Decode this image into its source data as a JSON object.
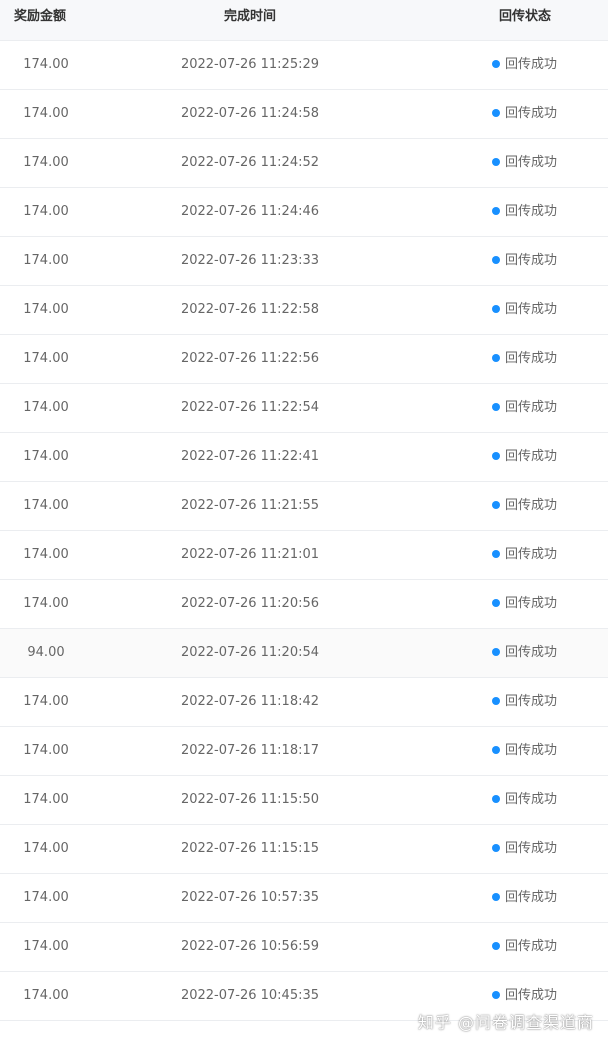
{
  "table": {
    "headers": {
      "amount": "奖励金额",
      "completed_time": "完成时间",
      "status": "回传状态"
    },
    "status_color": "#1890ff",
    "rows": [
      {
        "amount": "174.00",
        "time": "2022-07-26 11:25:29",
        "status": "回传成功"
      },
      {
        "amount": "174.00",
        "time": "2022-07-26 11:24:58",
        "status": "回传成功"
      },
      {
        "amount": "174.00",
        "time": "2022-07-26 11:24:52",
        "status": "回传成功"
      },
      {
        "amount": "174.00",
        "time": "2022-07-26 11:24:46",
        "status": "回传成功"
      },
      {
        "amount": "174.00",
        "time": "2022-07-26 11:23:33",
        "status": "回传成功"
      },
      {
        "amount": "174.00",
        "time": "2022-07-26 11:22:58",
        "status": "回传成功"
      },
      {
        "amount": "174.00",
        "time": "2022-07-26 11:22:56",
        "status": "回传成功"
      },
      {
        "amount": "174.00",
        "time": "2022-07-26 11:22:54",
        "status": "回传成功"
      },
      {
        "amount": "174.00",
        "time": "2022-07-26 11:22:41",
        "status": "回传成功"
      },
      {
        "amount": "174.00",
        "time": "2022-07-26 11:21:55",
        "status": "回传成功"
      },
      {
        "amount": "174.00",
        "time": "2022-07-26 11:21:01",
        "status": "回传成功"
      },
      {
        "amount": "174.00",
        "time": "2022-07-26 11:20:56",
        "status": "回传成功"
      },
      {
        "amount": "94.00",
        "time": "2022-07-26 11:20:54",
        "status": "回传成功",
        "highlight": true
      },
      {
        "amount": "174.00",
        "time": "2022-07-26 11:18:42",
        "status": "回传成功"
      },
      {
        "amount": "174.00",
        "time": "2022-07-26 11:18:17",
        "status": "回传成功"
      },
      {
        "amount": "174.00",
        "time": "2022-07-26 11:15:50",
        "status": "回传成功"
      },
      {
        "amount": "174.00",
        "time": "2022-07-26 11:15:15",
        "status": "回传成功"
      },
      {
        "amount": "174.00",
        "time": "2022-07-26 10:57:35",
        "status": "回传成功"
      },
      {
        "amount": "174.00",
        "time": "2022-07-26 10:56:59",
        "status": "回传成功"
      },
      {
        "amount": "174.00",
        "time": "2022-07-26 10:45:35",
        "status": "回传成功"
      }
    ]
  },
  "watermark": "知乎 @问卷调查渠道商"
}
